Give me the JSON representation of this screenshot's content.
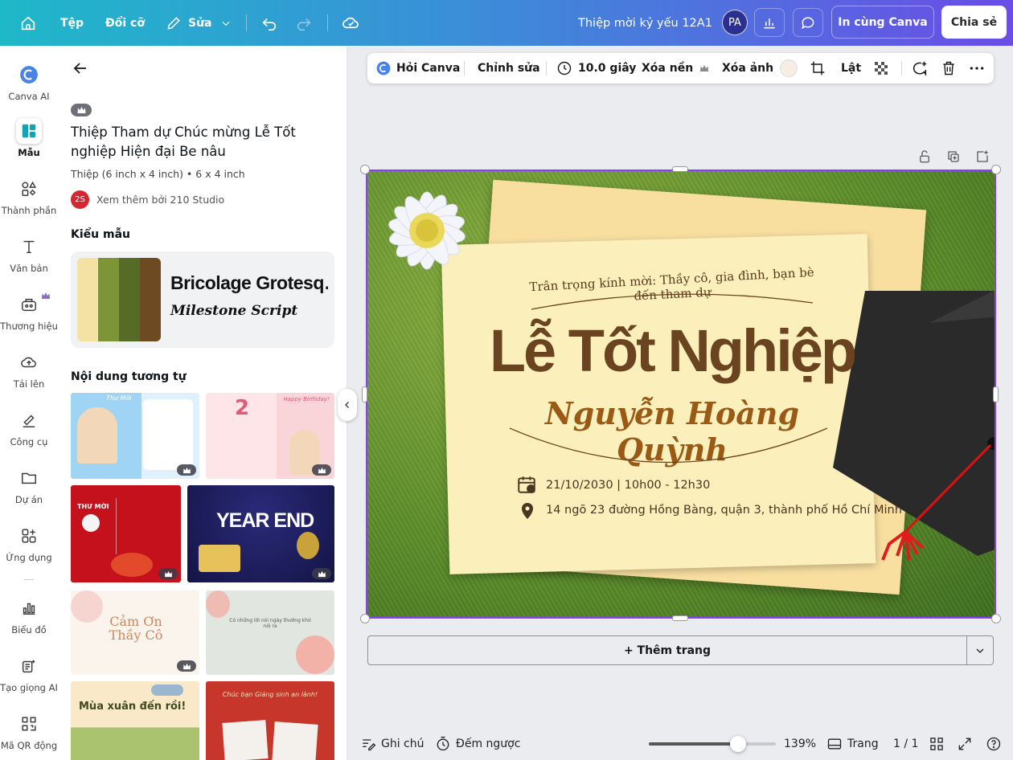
{
  "topbar": {
    "menu_file": "Tệp",
    "menu_resize": "Đổi cỡ",
    "menu_edit": "Sửa",
    "doc_title": "Thiệp mời kỷ yếu 12A1",
    "avatar_initials": "PA",
    "print_label": "In cùng Canva",
    "share_label": "Chia sẻ"
  },
  "rail": {
    "items": [
      {
        "label": "Canva AI"
      },
      {
        "label": "Mẫu"
      },
      {
        "label": "Thành phần"
      },
      {
        "label": "Văn bản"
      },
      {
        "label": "Thương hiệu"
      },
      {
        "label": "Tải lên"
      },
      {
        "label": "Công cụ"
      },
      {
        "label": "Dự án"
      },
      {
        "label": "Ứng dụng"
      },
      {
        "label": "Biểu đồ"
      },
      {
        "label": "Tạo giọng AI"
      },
      {
        "label": "Mã QR động"
      }
    ]
  },
  "panel": {
    "title": "Thiệp Tham dự Chúc mừng Lễ Tốt nghiệp Hiện đại Be nâu",
    "meta": "Thiệp (6 inch x 4 inch) • 6 x 4 inch",
    "author_initials": "2S",
    "author_link": "Xem thêm bởi 210 Studio",
    "style_heading": "Kiểu mẫu",
    "font_primary": "Bricolage Grotesq…",
    "font_secondary": "Milestone Script",
    "palette": [
      "#f3e2a4",
      "#7e9438",
      "#566b26",
      "#6e4a22"
    ],
    "similar_heading": "Nội dung tương tự",
    "thumbs": [
      {
        "text": "Thư Mời"
      },
      {
        "text": "Happy Birthday!"
      },
      {
        "text": "THƯ MỜI"
      },
      {
        "text": "YEAR END"
      },
      {
        "text": "Cảm Ơn Thầy Cô"
      },
      {
        "text": "Có những lời nói ngày thường khó nói ra"
      },
      {
        "text": "Mùa xuân đến rồi!"
      },
      {
        "text": "Chúc bạn Giáng sinh an lành!"
      }
    ]
  },
  "toolbar": {
    "ask_canva": "Hỏi Canva",
    "edit": "Chỉnh sửa",
    "duration": "10.0 giây",
    "remove_bg": "Xóa nền",
    "delete_image": "Xóa ảnh",
    "flip": "Lật"
  },
  "card": {
    "invite_line": "Trân trọng kính mời: Thầy cô, gia đình, bạn bè đến tham dự",
    "title": "Lễ Tốt Nghiệp",
    "name": "Nguyễn Hoàng Quỳnh",
    "datetime": "21/10/2030 | 10h00 - 12h30",
    "address": "14 ngõ 23 đường Hồng Bàng, quận 3, thành phố Hồ Chí Minh"
  },
  "add_page": "+ Thêm trang",
  "bottom": {
    "notes": "Ghi chú",
    "timer": "Đếm ngược",
    "zoom": "139%",
    "zoom_fraction": 0.7,
    "pages_label": "Trang",
    "page_count": "1 / 1"
  },
  "colors": {
    "accent": "#8b3dff",
    "title_brown": "#6a4420",
    "name_orange": "#9a5a16"
  }
}
